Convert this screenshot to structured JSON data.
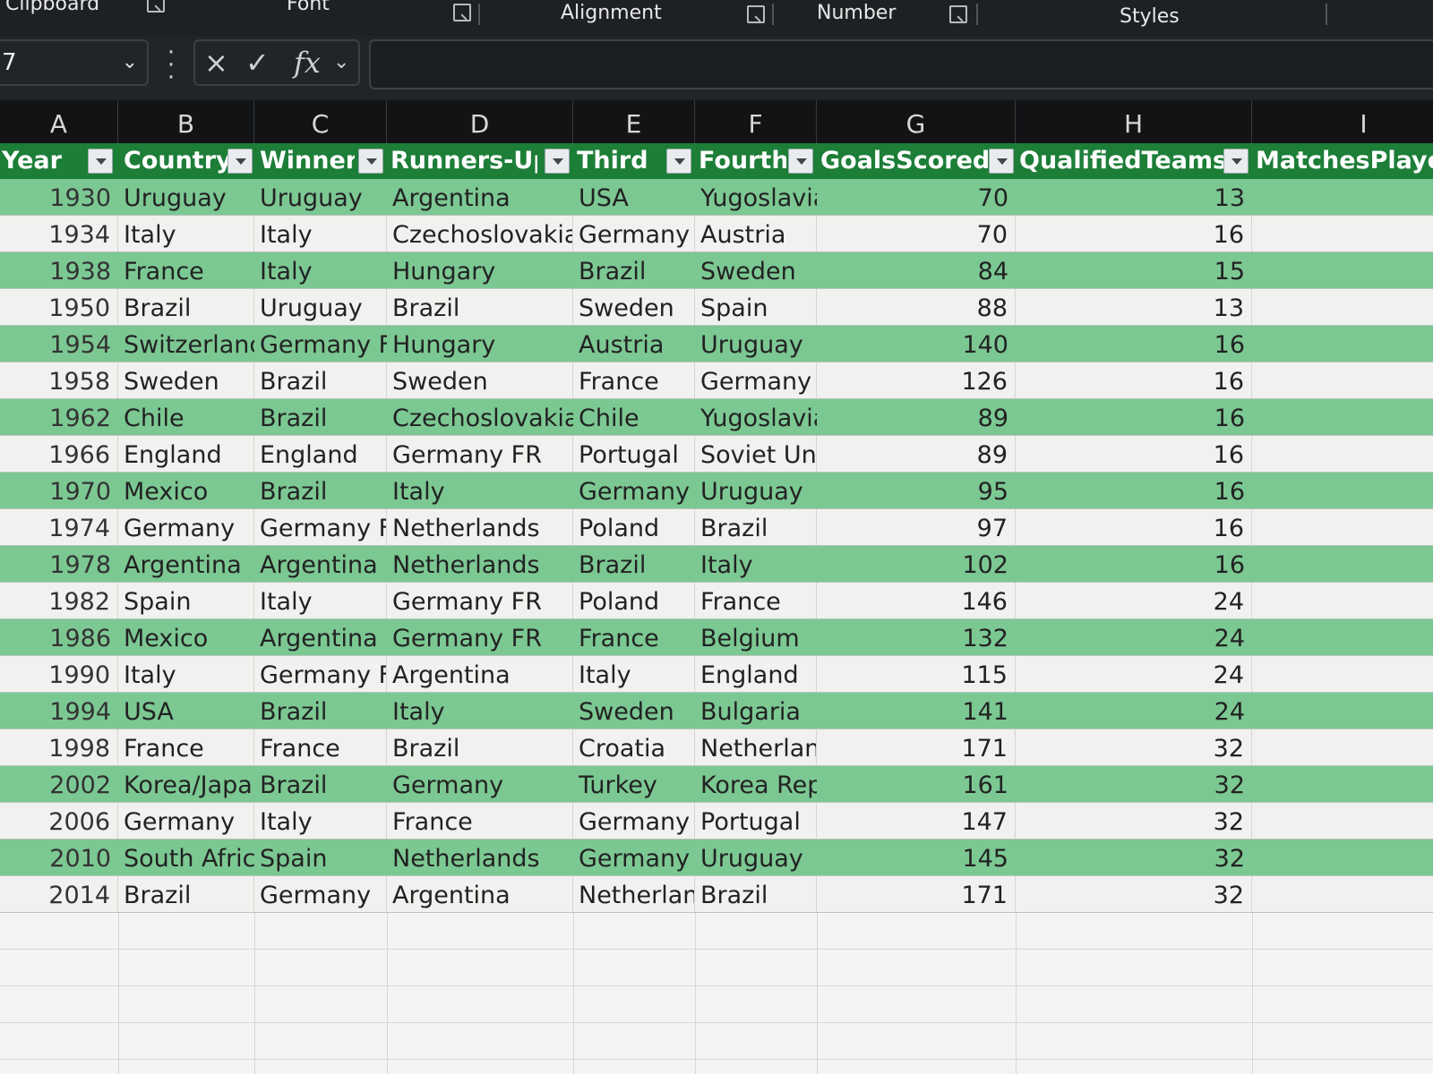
{
  "ribbon": {
    "groups": [
      "Clipboard",
      "Font",
      "Alignment",
      "Number",
      "Styles"
    ]
  },
  "formula_bar": {
    "name_box": "7",
    "cancel_icon": "×",
    "enter_icon": "✓",
    "fx_label": "fx",
    "formula": ""
  },
  "columns": [
    "A",
    "B",
    "C",
    "D",
    "E",
    "F",
    "G",
    "H",
    "I"
  ],
  "table": {
    "headers": [
      "Year",
      "Country",
      "Winner",
      "Runners-Up",
      "Third",
      "Fourth",
      "GoalsScored",
      "QualifiedTeams",
      "MatchesPlaye"
    ],
    "rows": [
      [
        "1930",
        "Uruguay",
        "Uruguay",
        "Argentina",
        "USA",
        "Yugoslavia",
        "70",
        "13"
      ],
      [
        "1934",
        "Italy",
        "Italy",
        "Czechoslovakia",
        "Germany",
        "Austria",
        "70",
        "16"
      ],
      [
        "1938",
        "France",
        "Italy",
        "Hungary",
        "Brazil",
        "Sweden",
        "84",
        "15"
      ],
      [
        "1950",
        "Brazil",
        "Uruguay",
        "Brazil",
        "Sweden",
        "Spain",
        "88",
        "13"
      ],
      [
        "1954",
        "Switzerland",
        "Germany FI",
        "Hungary",
        "Austria",
        "Uruguay",
        "140",
        "16"
      ],
      [
        "1958",
        "Sweden",
        "Brazil",
        "Sweden",
        "France",
        "Germany F",
        "126",
        "16"
      ],
      [
        "1962",
        "Chile",
        "Brazil",
        "Czechoslovakia",
        "Chile",
        "Yugoslavia",
        "89",
        "16"
      ],
      [
        "1966",
        "England",
        "England",
        "Germany FR",
        "Portugal",
        "Soviet Unic",
        "89",
        "16"
      ],
      [
        "1970",
        "Mexico",
        "Brazil",
        "Italy",
        "Germany F",
        "Uruguay",
        "95",
        "16"
      ],
      [
        "1974",
        "Germany",
        "Germany FI",
        "Netherlands",
        "Poland",
        "Brazil",
        "97",
        "16"
      ],
      [
        "1978",
        "Argentina",
        "Argentina",
        "Netherlands",
        "Brazil",
        "Italy",
        "102",
        "16"
      ],
      [
        "1982",
        "Spain",
        "Italy",
        "Germany FR",
        "Poland",
        "France",
        "146",
        "24"
      ],
      [
        "1986",
        "Mexico",
        "Argentina",
        "Germany FR",
        "France",
        "Belgium",
        "132",
        "24"
      ],
      [
        "1990",
        "Italy",
        "Germany FI",
        "Argentina",
        "Italy",
        "England",
        "115",
        "24"
      ],
      [
        "1994",
        "USA",
        "Brazil",
        "Italy",
        "Sweden",
        "Bulgaria",
        "141",
        "24"
      ],
      [
        "1998",
        "France",
        "France",
        "Brazil",
        "Croatia",
        "Netherlanc",
        "171",
        "32"
      ],
      [
        "2002",
        "Korea/Japar",
        "Brazil",
        "Germany",
        "Turkey",
        "Korea Repi",
        "161",
        "32"
      ],
      [
        "2006",
        "Germany",
        "Italy",
        "France",
        "Germany",
        "Portugal",
        "147",
        "32"
      ],
      [
        "2010",
        "South Africa",
        "Spain",
        "Netherlands",
        "Germany",
        "Uruguay",
        "145",
        "32"
      ],
      [
        "2014",
        "Brazil",
        "Germany",
        "Argentina",
        "Netherlanc",
        "Brazil",
        "171",
        "32"
      ]
    ]
  },
  "colors": {
    "header": "#1d7e38",
    "band": "#7cc893",
    "plain": "#f1f2ef"
  }
}
